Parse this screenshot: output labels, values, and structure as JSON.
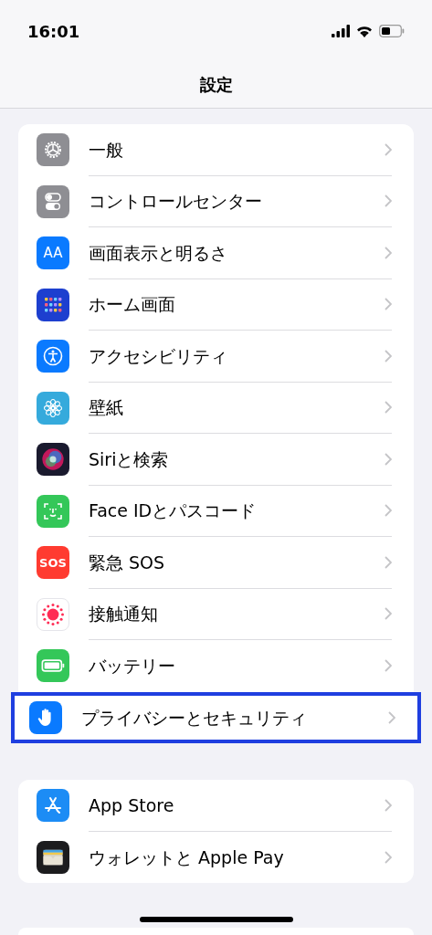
{
  "status_bar": {
    "time": "16:01"
  },
  "header": {
    "title": "設定"
  },
  "groups": [
    {
      "items": [
        {
          "kind": "gear",
          "label": "一般",
          "highlighted": false
        },
        {
          "kind": "toggles",
          "label": "コントロールセンター",
          "highlighted": false
        },
        {
          "kind": "display",
          "icon_text": "AA",
          "label": "画面表示と明るさ",
          "highlighted": false
        },
        {
          "kind": "grid",
          "label": "ホーム画面",
          "highlighted": false
        },
        {
          "kind": "accessibility",
          "label": "アクセシビリティ",
          "highlighted": false
        },
        {
          "kind": "flower",
          "label": "壁紙",
          "highlighted": false
        },
        {
          "kind": "siri",
          "label": "Siriと検索",
          "highlighted": false
        },
        {
          "kind": "faceid",
          "label": "Face IDとパスコード",
          "highlighted": false
        },
        {
          "kind": "sos",
          "icon_text": "SOS",
          "label": "緊急 SOS",
          "highlighted": false
        },
        {
          "kind": "exposure",
          "label": "接触通知",
          "highlighted": false
        },
        {
          "kind": "battery",
          "label": "バッテリー",
          "highlighted": false
        },
        {
          "kind": "hand",
          "label": "プライバシーとセキュリティ",
          "highlighted": true
        }
      ]
    },
    {
      "items": [
        {
          "kind": "appstore",
          "label": "App Store",
          "highlighted": false
        },
        {
          "kind": "wallet",
          "label": "ウォレットと Apple Pay",
          "highlighted": false
        }
      ]
    }
  ]
}
